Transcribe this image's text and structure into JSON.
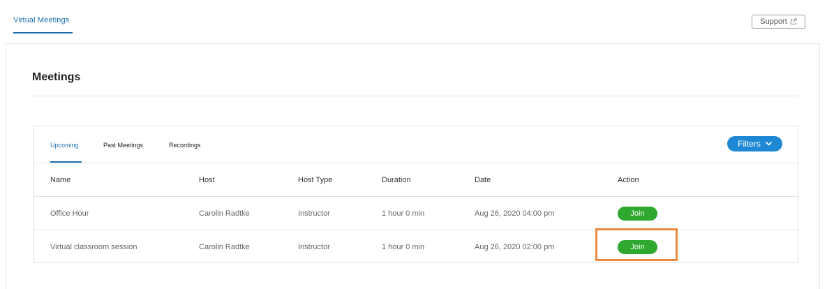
{
  "header": {
    "app_tab": "Virtual Meetings",
    "support_label": "Support",
    "support_icon": "external-link-icon"
  },
  "page": {
    "title": "Meetings"
  },
  "tabs": [
    {
      "label": "Upcoming",
      "active": true
    },
    {
      "label": "Past Meetings",
      "active": false
    },
    {
      "label": "Recordings",
      "active": false
    }
  ],
  "filters": {
    "label": "Filters",
    "icon": "chevron-down-icon"
  },
  "table": {
    "columns": [
      "Name",
      "Host",
      "Host Type",
      "Duration",
      "Date",
      "Action"
    ],
    "rows": [
      {
        "name": "Office Hour",
        "host": "Carolin Radtke",
        "host_type": "Instructor",
        "duration": "1 hour 0 min",
        "date": "Aug 26, 2020 04:00 pm",
        "action": "Join"
      },
      {
        "name": "Virtual classroom session",
        "host": "Carolin Radtke",
        "host_type": "Instructor",
        "duration": "1 hour 0 min",
        "date": "Aug 26, 2020 02:00 pm",
        "action": "Join"
      }
    ]
  },
  "colors": {
    "accent": "#1c6fb0",
    "filters_bg": "#1e88d4",
    "join_bg": "#2ea82e",
    "highlight": "#e98a3e"
  }
}
